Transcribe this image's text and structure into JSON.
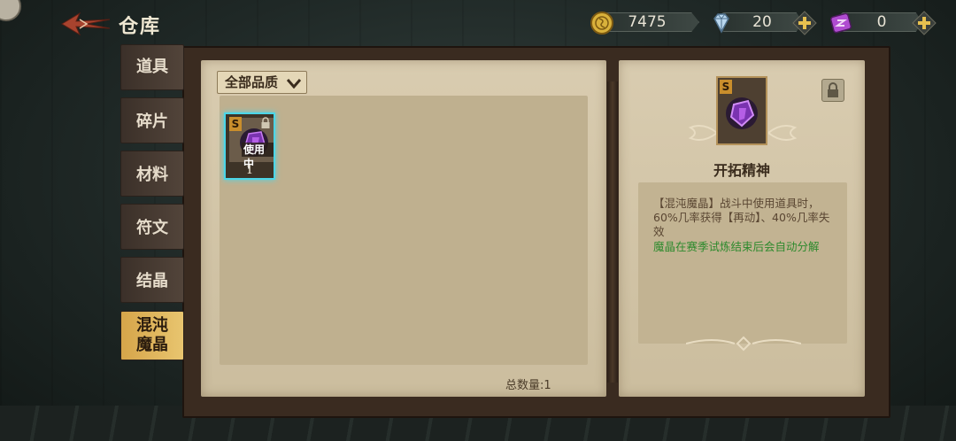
{
  "header": {
    "title": "仓库",
    "back_label": "back"
  },
  "resources": [
    {
      "name": "gold",
      "value": "7475",
      "icon": "coin-icon",
      "color": "#d9b13b"
    },
    {
      "name": "diamond",
      "value": "20",
      "icon": "diamond-icon",
      "color": "#b9d7ee"
    },
    {
      "name": "crystal",
      "value": "0",
      "icon": "crystal-ticket-icon",
      "color": "#b04cd1"
    }
  ],
  "tabs": [
    {
      "label": "道具",
      "active": false
    },
    {
      "label": "碎片",
      "active": false
    },
    {
      "label": "材料",
      "active": false
    },
    {
      "label": "符文",
      "active": false
    },
    {
      "label": "结晶",
      "active": false
    },
    {
      "label": "混沌\n魔晶",
      "active": true
    }
  ],
  "filter": {
    "label": "全部品质"
  },
  "items": [
    {
      "rarity": "S",
      "tag": "使用中",
      "count": "1",
      "locked": true,
      "selected": true
    }
  ],
  "total": "总数量:1",
  "detail": {
    "rarity": "S",
    "name": "开拓精神",
    "description": "【混沌魔晶】战斗中使用道具时，60%几率获得【再动】、40%几率失效",
    "note": "魔晶在赛季试炼结束后会自动分解"
  },
  "colors": {
    "accent_selected": "#4bd6e8",
    "tab_active": "#e0b659",
    "note_green": "#2d8a2d"
  }
}
